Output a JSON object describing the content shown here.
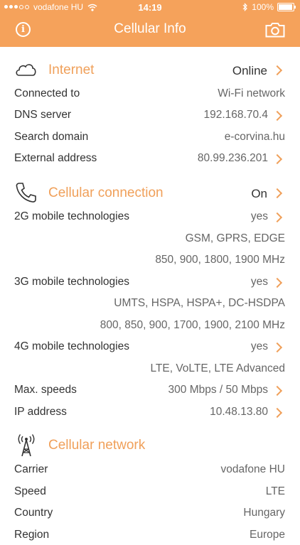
{
  "status_bar": {
    "carrier": "vodafone HU",
    "time": "14:19",
    "battery": "100%",
    "signal_bars": 3
  },
  "nav": {
    "title": "Cellular Info"
  },
  "internet": {
    "title": "Internet",
    "status": "Online",
    "rows": [
      {
        "label": "Connected to",
        "value": "Wi-Fi network"
      },
      {
        "label": "DNS server",
        "value": "192.168.70.4"
      },
      {
        "label": "Search domain",
        "value": "e-corvina.hu"
      },
      {
        "label": "External address",
        "value": "80.99.236.201"
      }
    ]
  },
  "cellular": {
    "title": "Cellular connection",
    "status": "On",
    "rows": [
      {
        "label": "2G mobile technologies",
        "value": "yes"
      },
      {
        "label": "",
        "value": "GSM, GPRS, EDGE"
      },
      {
        "label": "",
        "value": "850, 900, 1800, 1900 MHz"
      },
      {
        "label": "3G mobile technologies",
        "value": "yes"
      },
      {
        "label": "",
        "value": "UMTS, HSPA, HSPA+, DC-HSDPA"
      },
      {
        "label": "",
        "value": "800, 850, 900, 1700, 1900, 2100 MHz"
      },
      {
        "label": "4G mobile technologies",
        "value": "yes"
      },
      {
        "label": "",
        "value": "LTE, VoLTE, LTE Advanced"
      },
      {
        "label": "Max. speeds",
        "value": "300 Mbps / 50 Mbps"
      },
      {
        "label": "IP address",
        "value": "10.48.13.80"
      }
    ]
  },
  "network": {
    "title": "Cellular network",
    "rows": [
      {
        "label": "Carrier",
        "value": "vodafone HU"
      },
      {
        "label": "Speed",
        "value": "LTE"
      },
      {
        "label": "Country",
        "value": "Hungary"
      },
      {
        "label": "Region",
        "value": "Europe"
      }
    ]
  },
  "icons": {
    "info": "info-icon",
    "camera": "camera-icon",
    "internet": "cloud-icon",
    "cellular": "phone-handset-icon",
    "network": "antenna-tower-icon",
    "chevron": "chevron-right-icon"
  },
  "colors": {
    "header": "#f5a25b",
    "accent": "#f0a05a",
    "text": "#333333",
    "value_text": "#666666"
  }
}
